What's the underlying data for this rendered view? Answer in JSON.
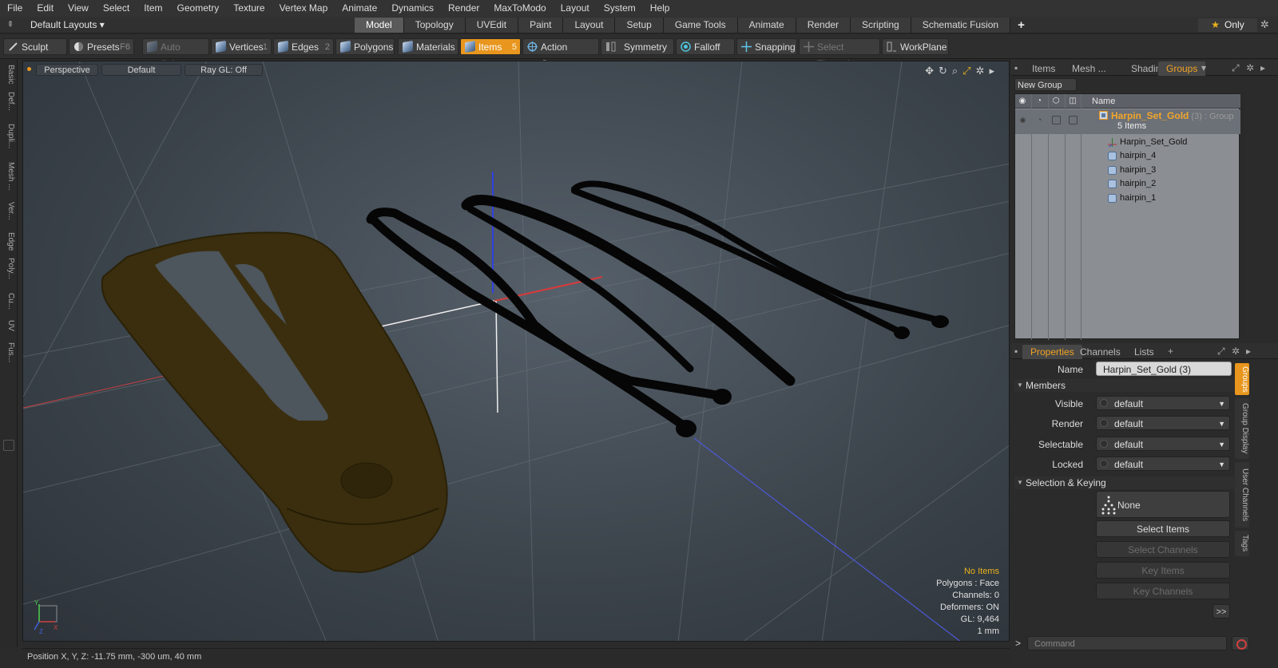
{
  "menu": [
    "File",
    "Edit",
    "View",
    "Select",
    "Item",
    "Geometry",
    "Texture",
    "Vertex Map",
    "Animate",
    "Dynamics",
    "Render",
    "MaxToModo",
    "Layout",
    "System",
    "Help"
  ],
  "layout_selector": "Default Layouts",
  "layout_tabs": [
    "Model",
    "Topology",
    "UVEdit",
    "Paint",
    "Layout",
    "Setup",
    "Game Tools",
    "Animate",
    "Render",
    "Scripting",
    "Schematic Fusion"
  ],
  "active_layout_tab": "Model",
  "only_button": "Only",
  "toolbar": {
    "sculpt": "Sculpt",
    "presets": "Presets",
    "presets_key": "F6",
    "auto_select": "Auto Select",
    "vertices": "Vertices",
    "vertices_count": "1",
    "edges": "Edges",
    "edges_count": "2",
    "polygons": "Polygons",
    "materials": "Materials",
    "items": "Items",
    "items_count": "5",
    "action_center": "Action Center",
    "symmetry": "Symmetry",
    "falloff": "Falloff",
    "snapping": "Snapping",
    "select_through": "Select Through",
    "workplane": "WorkPlane"
  },
  "left_tabs": [
    "Basic",
    "Def...",
    "Dupli...",
    "Mesh ...",
    "Ver...",
    "Edge",
    "Poly...",
    "Cu...",
    "UV",
    "Fus..."
  ],
  "viewport": {
    "view": "Perspective",
    "style": "Default",
    "raygl": "Ray GL: Off",
    "info": {
      "selection": "No Items",
      "polygons": "Polygons : Face",
      "channels": "Channels: 0",
      "deformers": "Deformers: ON",
      "gl": "GL: 9,464",
      "unit": "1 mm"
    },
    "axis_labels": {
      "x": "X",
      "y": "Y",
      "z": "Z"
    }
  },
  "status": "Position X, Y, Z:  -11.75 mm, -300 um, 40 mm",
  "outliner": {
    "tabs": [
      "Items",
      "Mesh ...",
      "Shading",
      "Groups"
    ],
    "active_tab": "Groups",
    "new_group": "New Group",
    "col_name": "Name",
    "group": {
      "name": "Harpin_Set_Gold",
      "suffix": "(3) : Group",
      "count": "5 Items"
    },
    "children": [
      "Harpin_Set_Gold",
      "hairpin_4",
      "hairpin_3",
      "hairpin_2",
      "hairpin_1"
    ]
  },
  "properties": {
    "tabs": [
      "Properties",
      "Channels",
      "Lists"
    ],
    "active_tab": "Properties",
    "name_label": "Name",
    "name_value": "Harpin_Set_Gold (3)",
    "members_section": "Members",
    "fields": [
      {
        "label": "Visible",
        "value": "default"
      },
      {
        "label": "Render",
        "value": "default"
      },
      {
        "label": "Selectable",
        "value": "default"
      },
      {
        "label": "Locked",
        "value": "default"
      }
    ],
    "keying_section": "Selection & Keying",
    "none_button": "None",
    "select_items": "Select Items",
    "select_channels": "Select Channels",
    "key_items": "Key Items",
    "key_channels": "Key Channels",
    "more": ">>"
  },
  "right_side_tabs": [
    "Groups",
    "Group Display",
    "User Channels",
    "Tags"
  ],
  "command_placeholder": "Command",
  "colors": {
    "accent": "#e8961d",
    "group_name": "#f2a72a",
    "warning_text": "#e8b21c"
  }
}
